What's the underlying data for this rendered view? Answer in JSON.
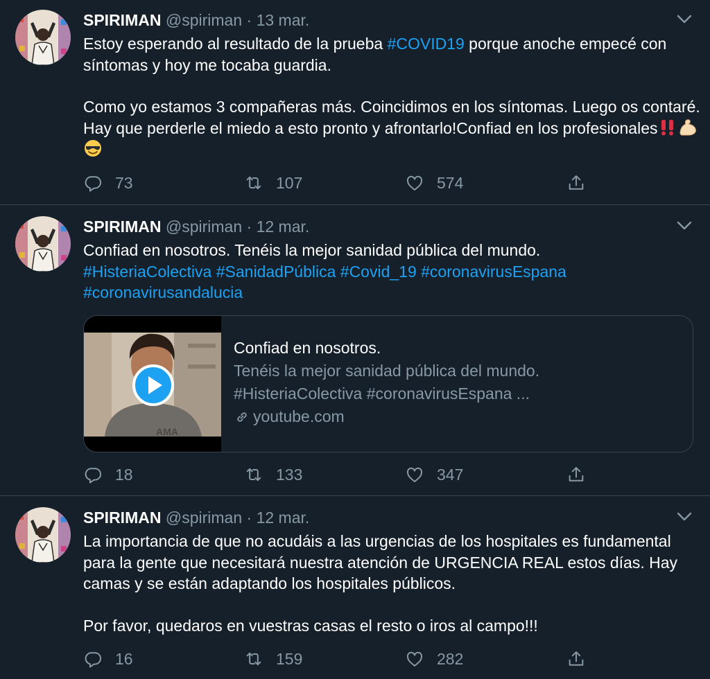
{
  "tweets": [
    {
      "name": "SPIRIMAN",
      "handle": "@spiriman",
      "separator": "·",
      "date": "13 mar.",
      "line1_a": "Estoy esperando al resultado de la prueba ",
      "line1_hashtag": "#COVID19",
      "line1_b": " porque anoche empecé con síntomas y hoy me tocaba guardia.",
      "para2": "Como yo estamos 3 compañeras más. Coincidimos en los síntomas. Luego os contaré. Hay que perderle el miedo a esto pronto y afrontarlo!Confiad en los profesionales",
      "emojis": [
        "double-exclamation-emoji",
        "flexed-biceps-emoji",
        "smiling-face-with-sunglasses-emoji"
      ],
      "replies": "73",
      "retweets": "107",
      "likes": "574"
    },
    {
      "name": "SPIRIMAN",
      "handle": "@spiriman",
      "separator": "·",
      "date": "12 mar.",
      "line1": "Confiad en nosotros. Tenéis la mejor sanidad pública del mundo.",
      "hashtags": [
        "#HisteriaColectiva",
        "#SanidadPública",
        "#Covid_19",
        "#coronavirusEspana",
        "#coronavirusandalucia"
      ],
      "card": {
        "title": "Confiad en nosotros.",
        "description_1": "Tenéis la mejor sanidad pública del mundo.",
        "description_2": "#HisteriaColectiva #coronavirusEspana ...",
        "domain": "youtube.com"
      },
      "replies": "18",
      "retweets": "133",
      "likes": "347"
    },
    {
      "name": "SPIRIMAN",
      "handle": "@spiriman",
      "separator": "·",
      "date": "12 mar.",
      "para1": "La importancia de que no acudáis a las urgencias de los hospitales es fundamental para la gente que necesitará nuestra atención de URGENCIA REAL estos días. Hay camas y se están adaptando los hospitales públicos.",
      "para2": "Por favor, quedaros en vuestras casas el resto o iros al campo!!!",
      "replies": "16",
      "retweets": "159",
      "likes": "282"
    }
  ],
  "colors": {
    "background": "#15202b",
    "divider": "#38444d",
    "secondary_text": "#8899a6",
    "link": "#1da1f2",
    "play_button": "#1da1f2"
  },
  "icons": [
    "avatar",
    "chevron-down-icon",
    "reply-icon",
    "retweet-icon",
    "like-icon",
    "share-icon",
    "play-icon",
    "link-icon"
  ]
}
